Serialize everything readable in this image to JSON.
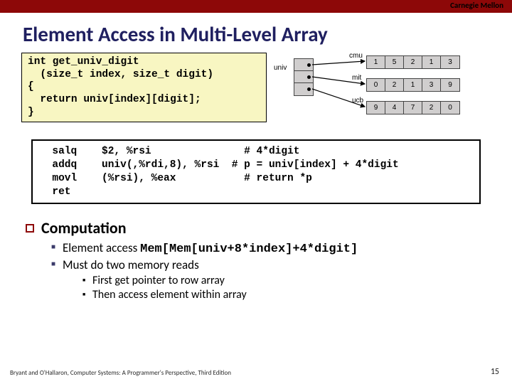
{
  "brand": "Carnegie Mellon",
  "title": "Element Access in Multi-Level Array",
  "code": {
    "l1": "int get_univ_digit",
    "l2": "  (size_t index, size_t digit)",
    "l3": "{",
    "l4": "  return univ[index][digit];",
    "l5": "}"
  },
  "diagram": {
    "univ_label": "univ",
    "rows": [
      "cmu",
      "mit",
      "ucb"
    ],
    "cmu": [
      "1",
      "5",
      "2",
      "1",
      "3"
    ],
    "mit": [
      "0",
      "2",
      "1",
      "3",
      "9"
    ],
    "ucb": [
      "9",
      "4",
      "7",
      "2",
      "0"
    ]
  },
  "asm": {
    "l1": "  salq    $2, %rsi               # 4*digit",
    "l2": "  addq    univ(,%rdi,8), %rsi  # p = univ[index] + 4*digit",
    "l3": "  movl    (%rsi), %eax           # return *p",
    "l4": "  ret"
  },
  "section_heading": "Computation",
  "bullets": {
    "b1_pre": "Element access ",
    "b1_code": "Mem[Mem[univ+8*index]+4*digit]",
    "b2": "Must do two memory reads",
    "b2a": "First get pointer to row array",
    "b2b": "Then access element within array"
  },
  "footer": "Bryant and O'Hallaron, Computer Systems: A Programmer's Perspective, Third Edition",
  "page": "15"
}
